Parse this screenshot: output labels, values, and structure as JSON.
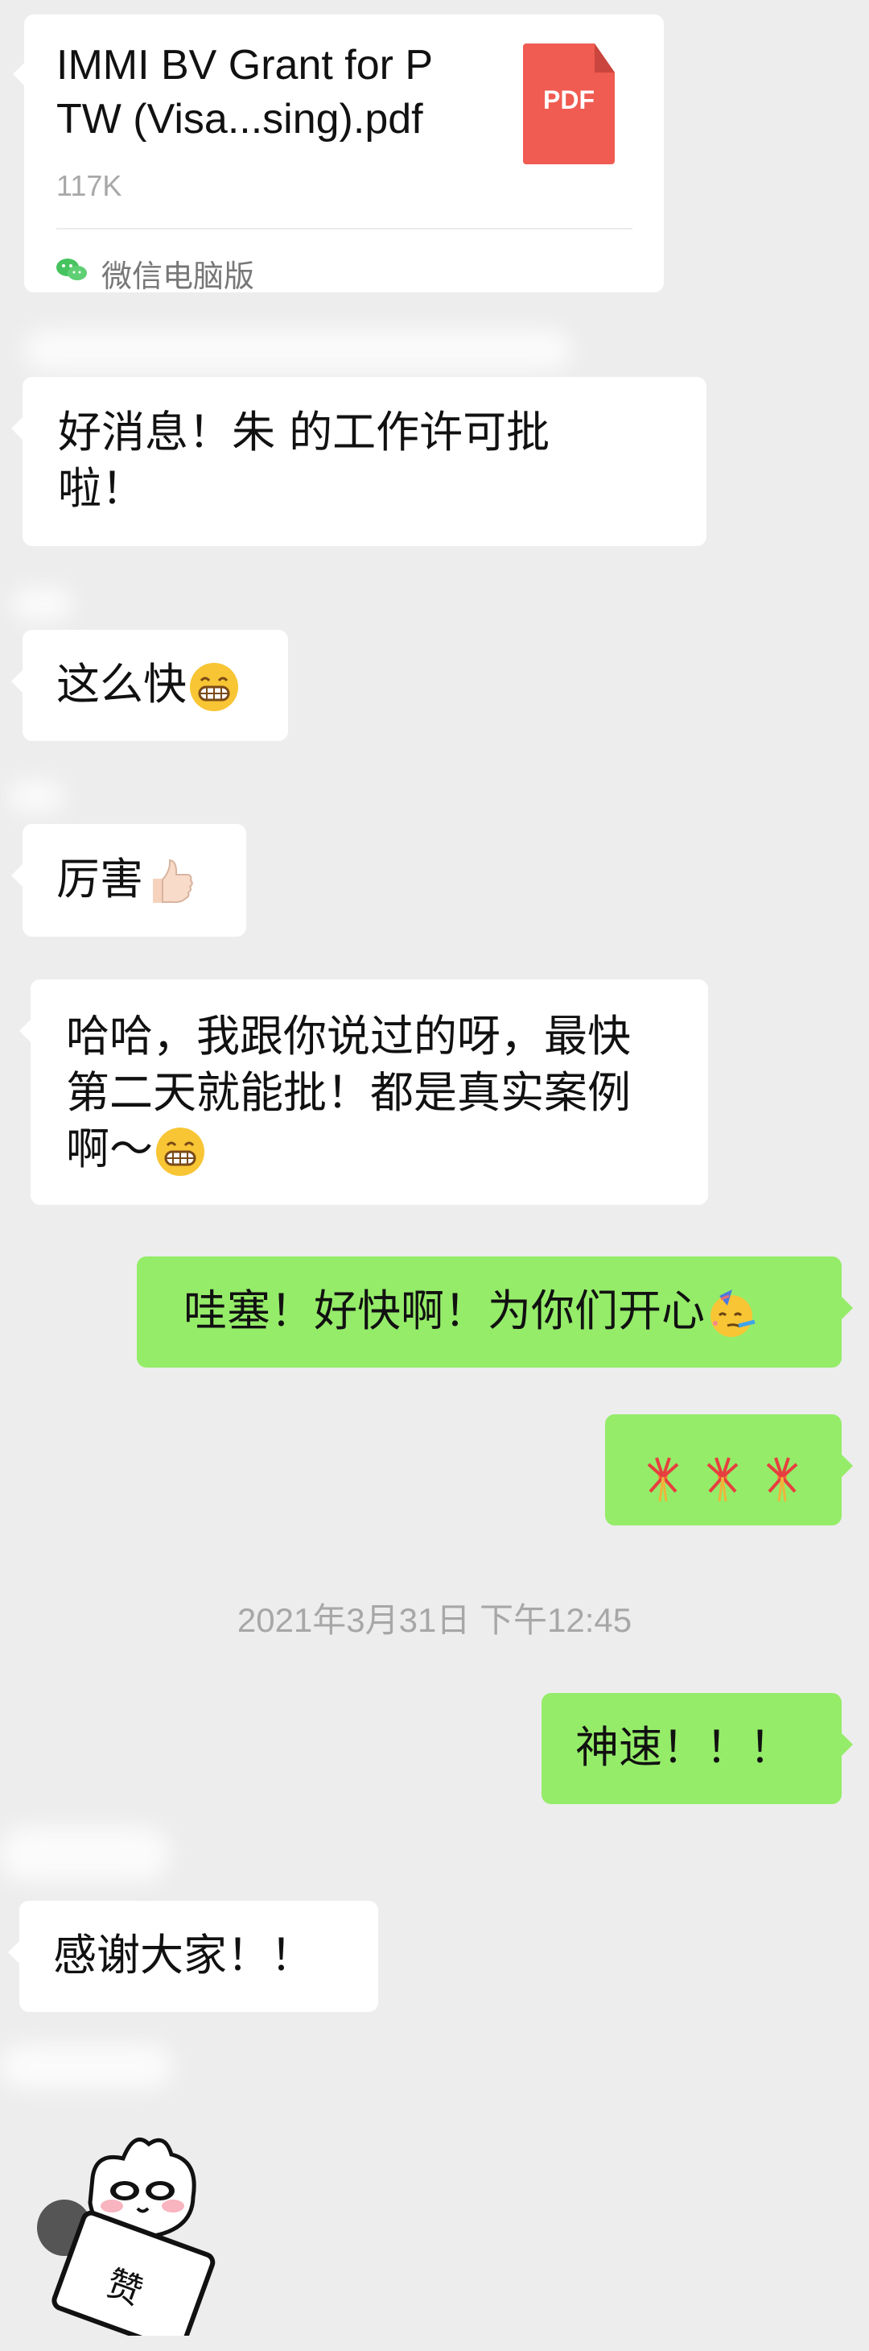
{
  "file_message": {
    "name": "IMMI BV Grant for P\nTW (Visa...sing).pdf",
    "size": "117K",
    "source": "微信电脑版",
    "file_type": "PDF"
  },
  "messages": [
    {
      "text": "好消息！朱       的工作许可批\n啦！"
    },
    {
      "text": "这么快"
    },
    {
      "text": "厉害"
    },
    {
      "text": "哈哈，我跟你说过的呀，最快\n第二天就能批！都是真实案例\n啊～"
    },
    {
      "text": "哇塞！好快啊！为你们开心"
    },
    {
      "text": "神速！！！"
    },
    {
      "text": "感谢大家！！"
    }
  ],
  "timestamp": "2021年3月31日 下午12:45",
  "sticker": {
    "text": "赞"
  }
}
